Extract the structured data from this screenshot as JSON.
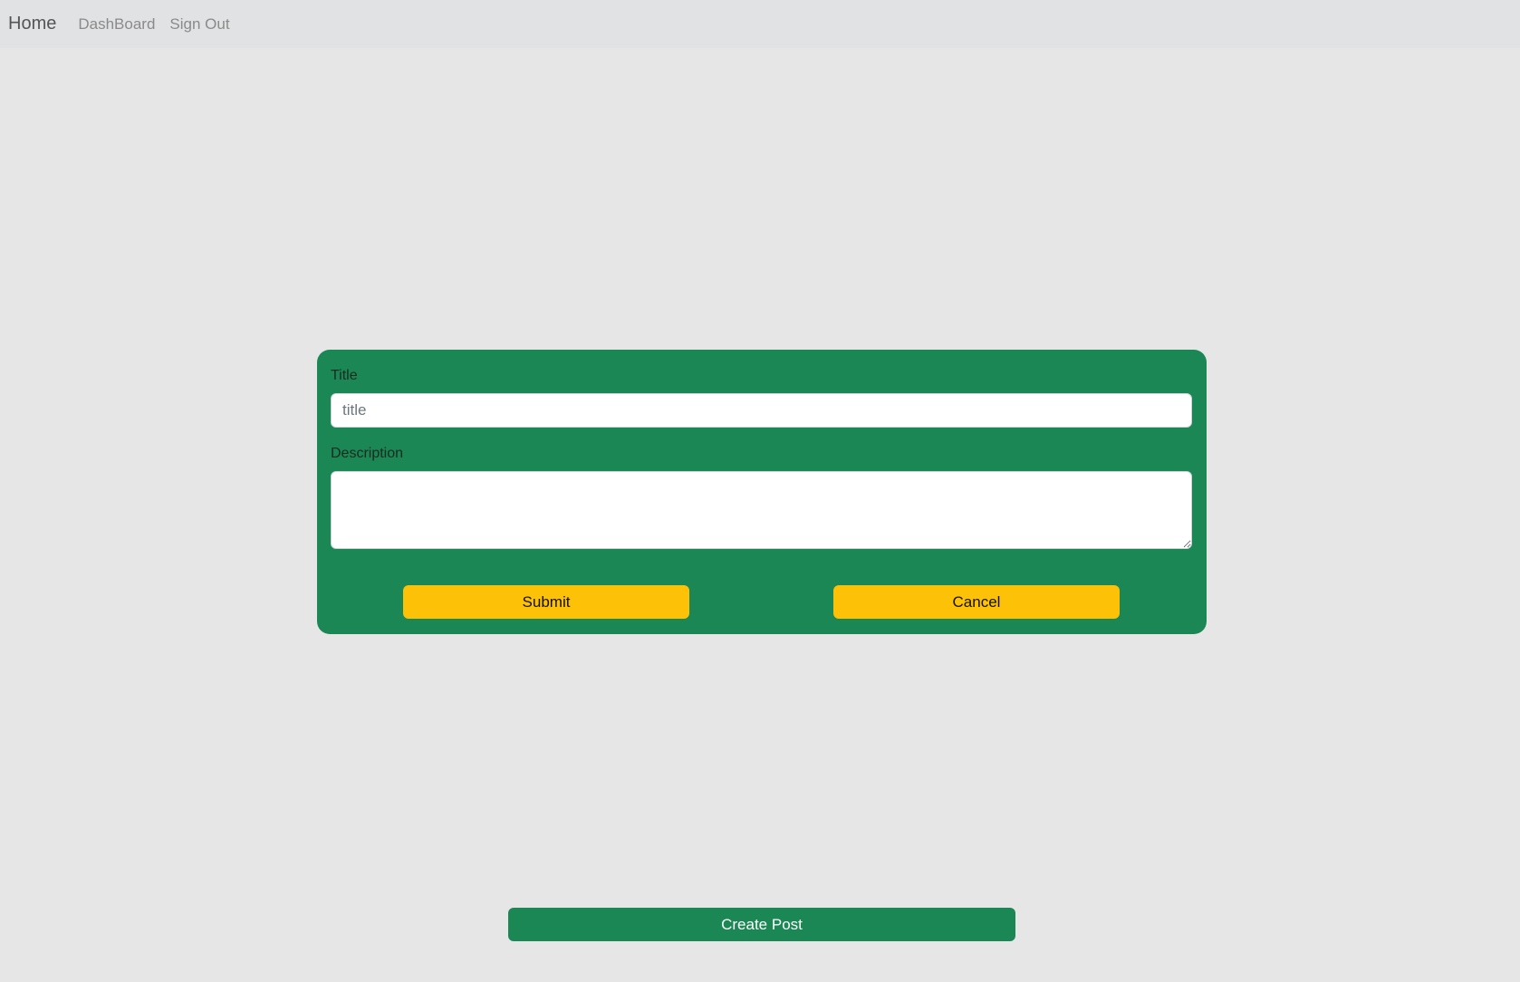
{
  "navbar": {
    "brand": "Home",
    "links": [
      "DashBoard",
      "Sign Out"
    ]
  },
  "form": {
    "title_label": "Title",
    "title_placeholder": "title",
    "title_value": "",
    "description_label": "Description",
    "description_value": "",
    "submit_label": "Submit",
    "cancel_label": "Cancel"
  },
  "create_post_label": "Create Post",
  "colors": {
    "background": "#e6e6e6",
    "navbar": "#e1e2e4",
    "panel_green": "#1b8754",
    "button_yellow": "#fdc107"
  }
}
